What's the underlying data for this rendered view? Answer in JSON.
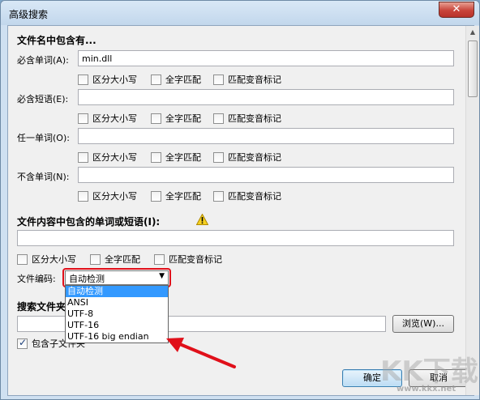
{
  "window": {
    "title": "高级搜索",
    "close_label": "✕"
  },
  "filename_section": {
    "title": "文件名中包含有...",
    "rows": [
      {
        "label": "必含单词(A):",
        "value": "min.dll"
      },
      {
        "label": "必含短语(E):",
        "value": ""
      },
      {
        "label": "任一单词(O):",
        "value": ""
      },
      {
        "label": "不含单词(N):",
        "value": ""
      }
    ],
    "options": [
      "区分大小写",
      "全字匹配",
      "匹配变音标记"
    ]
  },
  "content_section": {
    "title": "文件内容中包含的单词或短语(I):",
    "value": "",
    "options": [
      "区分大小写",
      "全字匹配",
      "匹配变音标记"
    ],
    "encoding_label": "文件编码:",
    "encoding_value": "自动检测",
    "encoding_options": [
      "自动检测",
      "ANSI",
      "UTF-8",
      "UTF-16",
      "UTF-16 big endian"
    ],
    "selected_index": 0
  },
  "folder_section": {
    "title_visible": "搜索文件夹",
    "value": "",
    "browse_label": "浏览(W)...",
    "include_subfolders_label": "包含子文件夹",
    "include_subfolders_checked": true
  },
  "footer": {
    "ok_label": "确定",
    "cancel_label": "取消"
  },
  "watermark": {
    "brand": "KK下载",
    "url": "www.kkx.net"
  },
  "colors": {
    "highlight": "#e0101a",
    "selection": "#3399ff"
  }
}
